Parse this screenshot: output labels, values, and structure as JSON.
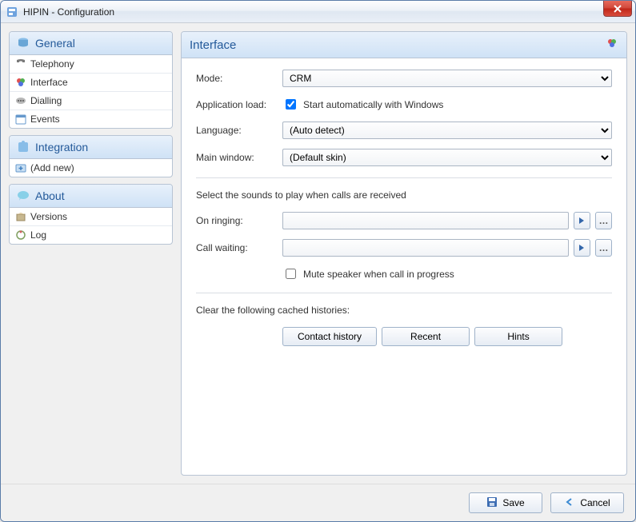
{
  "window": {
    "title": "HIPIN - Configuration"
  },
  "sidebar": {
    "groups": [
      {
        "header": "General",
        "items": [
          {
            "label": "Telephony"
          },
          {
            "label": "Interface"
          },
          {
            "label": "Dialling"
          },
          {
            "label": "Events"
          }
        ]
      },
      {
        "header": "Integration",
        "items": [
          {
            "label": "(Add new)"
          }
        ]
      },
      {
        "header": "About",
        "items": [
          {
            "label": "Versions"
          },
          {
            "label": "Log"
          }
        ]
      }
    ]
  },
  "panel": {
    "title": "Interface",
    "mode": {
      "label": "Mode:",
      "value": "CRM"
    },
    "appload": {
      "label": "Application load:",
      "checkbox_label": "Start automatically with Windows",
      "checked": true
    },
    "language": {
      "label": "Language:",
      "value": "(Auto detect)"
    },
    "mainwindow": {
      "label": "Main window:",
      "value": "(Default skin)"
    },
    "sounds_section": "Select the sounds to play when calls are received",
    "on_ringing": {
      "label": "On ringing:",
      "value": ""
    },
    "call_waiting": {
      "label": "Call waiting:",
      "value": ""
    },
    "mute": {
      "label": "Mute speaker when call in progress",
      "checked": false
    },
    "clear_section": "Clear the following cached histories:",
    "clear_buttons": {
      "contact": "Contact history",
      "recent": "Recent",
      "hints": "Hints"
    }
  },
  "footer": {
    "save": "Save",
    "cancel": "Cancel"
  }
}
